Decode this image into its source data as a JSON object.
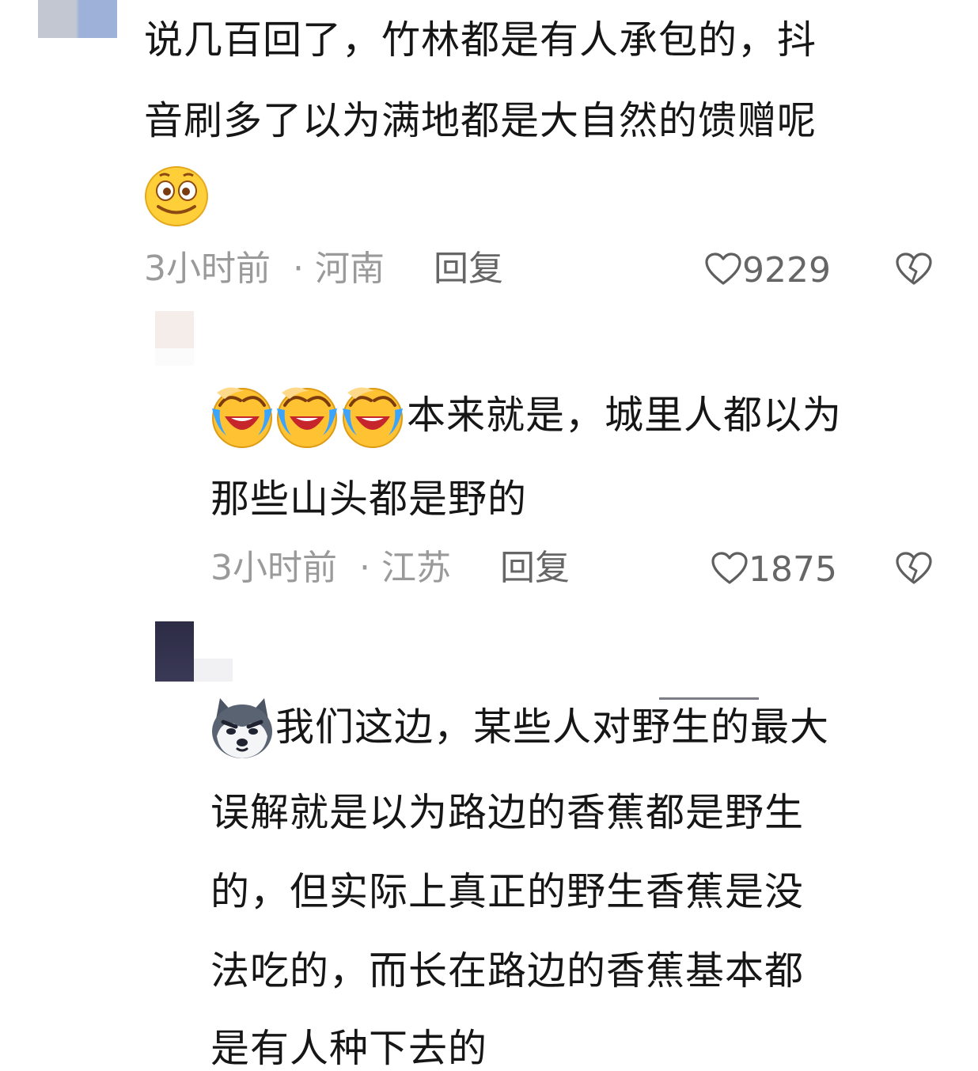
{
  "comments": [
    {
      "lines": [
        "说几百回了，竹林都是有人承包的，抖",
        "音刷多了以为满地都是大自然的馈赠呢"
      ],
      "emoji": "smile-emoji",
      "time": "3小时前",
      "location": "· 河南",
      "reply": "回复",
      "likes": "9229",
      "like_icon": "heart-outline-icon",
      "dislike_icon": "broken-heart-icon"
    },
    {
      "emojis": [
        "laugh-cry-emoji",
        "laugh-cry-emoji",
        "laugh-cry-emoji"
      ],
      "lines": [
        "本来就是，城里人都以为",
        "那些山头都是野的"
      ],
      "time": "3小时前",
      "location": "· 江苏",
      "reply": "回复",
      "likes": "1875",
      "like_icon": "heart-outline-icon",
      "dislike_icon": "broken-heart-icon"
    },
    {
      "emoji": "husky-dog-emoji",
      "lines": [
        "我们这边，某些人对野生的最大",
        "误解就是以为路边的香蕉都是野生",
        "的，但实际上真正的野生香蕉是没",
        "法吃的，而长在路边的香蕉基本都",
        "是有人种下去的"
      ]
    }
  ],
  "colors": {
    "text": "#161616",
    "meta": "#9a9a9a",
    "reply": "#666666",
    "background": "#ffffff"
  }
}
